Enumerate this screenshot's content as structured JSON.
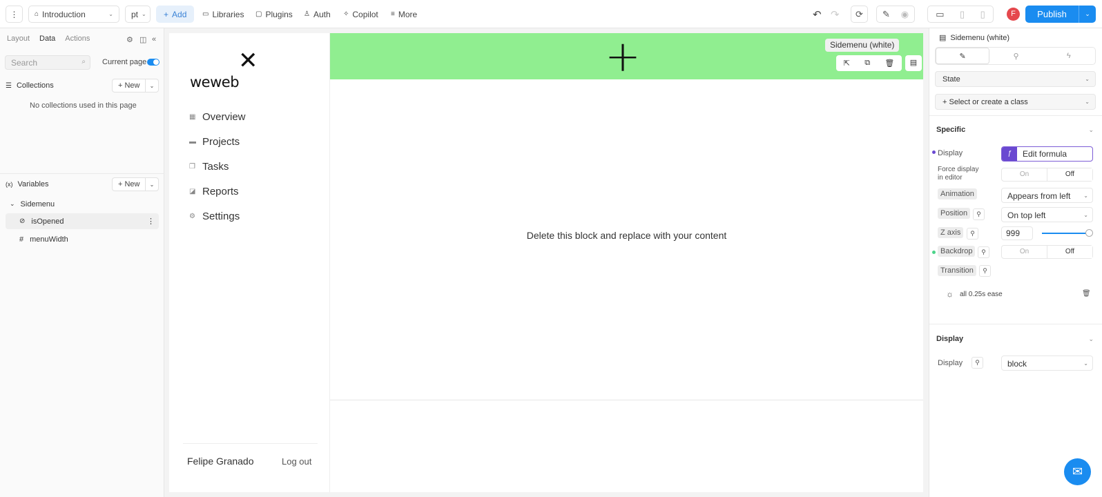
{
  "topbar": {
    "page_select": "Introduction",
    "lang_select": "pt",
    "add": "Add",
    "libraries": "Libraries",
    "plugins": "Plugins",
    "auth": "Auth",
    "copilot": "Copilot",
    "more": "More",
    "avatar_initial": "F",
    "publish": "Publish"
  },
  "left": {
    "tabs": [
      "Layout",
      "Data",
      "Actions"
    ],
    "search_placeholder": "Search",
    "current_page": "Current page",
    "collections_title": "Collections",
    "new_label": "New",
    "no_collections": "No collections used in this page",
    "variables_title": "Variables",
    "var_icon": "(x)",
    "group": "Sidemenu",
    "vars": [
      {
        "name": "isOpened",
        "icon": "⊘"
      },
      {
        "name": "menuWidth",
        "icon": "#"
      }
    ]
  },
  "canvas": {
    "logo": "weweb",
    "nav": [
      {
        "label": "Overview",
        "icon": "grid-icon"
      },
      {
        "label": "Projects",
        "icon": "folder-icon"
      },
      {
        "label": "Tasks",
        "icon": "tasks-icon"
      },
      {
        "label": "Reports",
        "icon": "chart-icon"
      },
      {
        "label": "Settings",
        "icon": "gear-icon"
      }
    ],
    "user": "Felipe Granado",
    "logout": "Log out",
    "selected_tag": "Sidemenu (white)",
    "placeholder": "Delete this block and replace with your content",
    "green": "#90ee90"
  },
  "right": {
    "title": "Sidemenu (white)",
    "state": "State",
    "class_select": "+ Select or create a class",
    "specific": "Specific",
    "display_label": "Display",
    "edit_formula": "Edit formula",
    "force_display": "Force display in editor",
    "on": "On",
    "off": "Off",
    "animation": "Animation",
    "animation_value": "Appears from left",
    "position": "Position",
    "position_value": "On top left",
    "z_axis": "Z axis",
    "z_value": "999",
    "backdrop": "Backdrop",
    "transition": "Transition",
    "transition_value": "all 0.25s ease",
    "display_section": "Display",
    "display_value": "block"
  }
}
